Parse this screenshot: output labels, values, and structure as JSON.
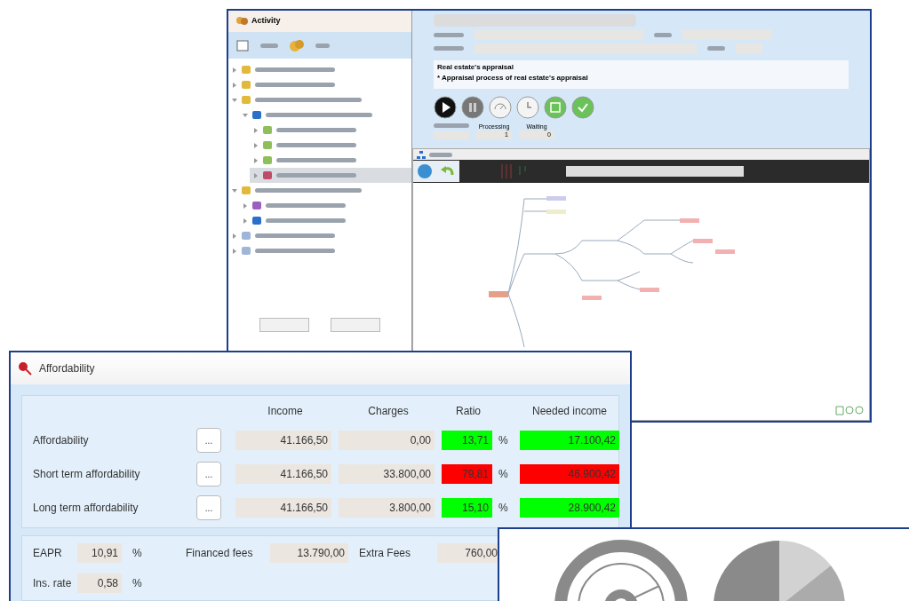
{
  "activity_window": {
    "title": "Activity",
    "tree": [
      {
        "kind": "folder",
        "selected": false,
        "expanded": false
      },
      {
        "kind": "folder",
        "selected": false,
        "expanded": false
      },
      {
        "kind": "folder",
        "selected": false,
        "expanded": true,
        "children": [
          {
            "kind": "doc",
            "selected": false,
            "expanded": true,
            "children": [
              {
                "kind": "task",
                "selected": false,
                "expanded": false
              },
              {
                "kind": "task",
                "selected": false,
                "expanded": false
              },
              {
                "kind": "task",
                "selected": false,
                "expanded": false
              },
              {
                "kind": "pen",
                "selected": true,
                "expanded": false
              }
            ]
          }
        ]
      },
      {
        "kind": "folder",
        "selected": false,
        "expanded": true,
        "children": [
          {
            "kind": "check",
            "selected": false,
            "expanded": false
          },
          {
            "kind": "doc",
            "selected": false,
            "expanded": false
          }
        ]
      },
      {
        "kind": "page",
        "selected": false,
        "expanded": false
      },
      {
        "kind": "page",
        "selected": false,
        "expanded": false
      }
    ],
    "heading": "Real estate's appraisal",
    "subheading": "* Appraisal process of real estate's appraisal",
    "actions": [
      {
        "kind": "play"
      },
      {
        "kind": "pause"
      },
      {
        "kind": "gauge"
      },
      {
        "kind": "clock"
      },
      {
        "kind": "save"
      },
      {
        "kind": "done"
      }
    ],
    "counters": [
      {
        "label": "Processing",
        "value": "1"
      },
      {
        "label": "Waiting",
        "value": "0"
      }
    ]
  },
  "affordability": {
    "title": "Affordability",
    "columns": [
      "Income",
      "Charges",
      "Ratio",
      "Needed income"
    ],
    "rows": [
      {
        "label": "Affordability",
        "button": "...",
        "income": "41.166,50",
        "charges": "0,00",
        "ratio": "13,71",
        "unit": "%",
        "needed": "17.100,42",
        "alert": false
      },
      {
        "label": "Short term affordability",
        "button": "...",
        "income": "41.166,50",
        "charges": "33.800,00",
        "ratio": "79,81",
        "unit": "%",
        "needed": "46.900,42",
        "alert": true
      },
      {
        "label": "Long term affordability",
        "button": "...",
        "income": "41.166,50",
        "charges": "3.800,00",
        "ratio": "15,10",
        "unit": "%",
        "needed": "28.900,42",
        "alert": false
      }
    ],
    "eapr": {
      "label": "EAPR",
      "value": "10,91",
      "unit": "%"
    },
    "financed_fees": {
      "label": "Financed fees",
      "value": "13.790,00"
    },
    "extra_fees": {
      "label": "Extra Fees",
      "value": "760,00"
    },
    "ins_rate": {
      "label": "Ins. rate",
      "value": "0,58",
      "unit": "%"
    }
  }
}
